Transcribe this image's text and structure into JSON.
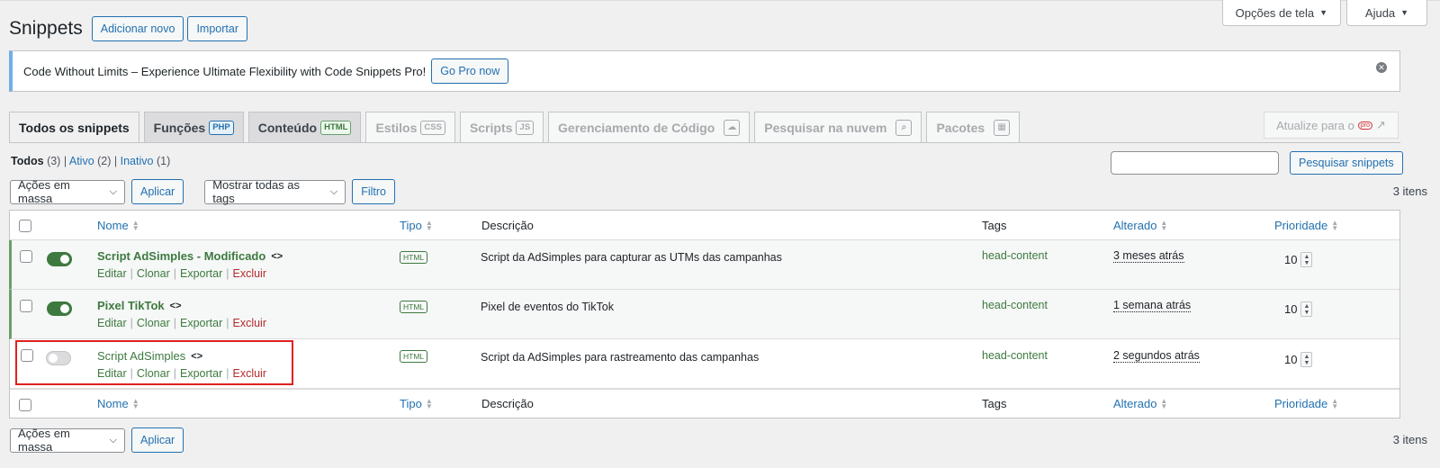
{
  "screen_options": {
    "label": "Opções de tela",
    "help": "Ajuda"
  },
  "header": {
    "title": "Snippets",
    "add_new": "Adicionar novo",
    "import": "Importar"
  },
  "notice": {
    "message": "Code Without Limits – Experience Ultimate Flexibility with Code Snippets Pro!",
    "button": "Go Pro now"
  },
  "tabs": [
    {
      "label": "Todos os snippets"
    },
    {
      "label": "Funções",
      "badge": "PHP"
    },
    {
      "label": "Conteúdo",
      "badge": "HTML"
    },
    {
      "label": "Estilos",
      "badge": "CSS"
    },
    {
      "label": "Scripts",
      "badge": "JS"
    },
    {
      "label": "Gerenciamento de Código"
    },
    {
      "label": "Pesquisar na nuvem"
    },
    {
      "label": "Pacotes"
    }
  ],
  "upgrade": {
    "label": "Atualize para o",
    "badge": "pro"
  },
  "filters": {
    "all": "Todos",
    "all_count": "(3)",
    "active": "Ativo",
    "active_count": "(2)",
    "inactive": "Inativo",
    "inactive_count": "(1)"
  },
  "search": {
    "button": "Pesquisar snippets"
  },
  "bulk": {
    "select": "Ações em massa",
    "apply": "Aplicar",
    "tags_select": "Mostrar todas as tags",
    "filter": "Filtro",
    "count": "3 itens"
  },
  "columns": {
    "name": "Nome",
    "type": "Tipo",
    "description": "Descrição",
    "tags": "Tags",
    "modified": "Alterado",
    "priority": "Prioridade"
  },
  "row_actions": {
    "edit": "Editar",
    "clone": "Clonar",
    "export": "Exportar",
    "delete": "Excluir"
  },
  "snippets": [
    {
      "name": "Script AdSimples - Modificado",
      "active": true,
      "type": "HTML",
      "description": "Script da AdSimples para capturar as UTMs das campanhas",
      "tag": "head-content",
      "modified": "3 meses atrás",
      "priority": "10"
    },
    {
      "name": "Pixel TikTok",
      "active": true,
      "type": "HTML",
      "description": "Pixel de eventos do TikTok",
      "tag": "head-content",
      "modified": "1 semana atrás",
      "priority": "10"
    },
    {
      "name": "Script AdSimples",
      "active": false,
      "type": "HTML",
      "description": "Script da AdSimples para rastreamento das campanhas",
      "tag": "head-content",
      "modified": "2 segundos atrás",
      "priority": "10"
    }
  ],
  "colors": {
    "accent": "#2271b1",
    "active_green": "#3d7a3f",
    "danger": "#b32d2e",
    "highlight": "#e02020"
  }
}
